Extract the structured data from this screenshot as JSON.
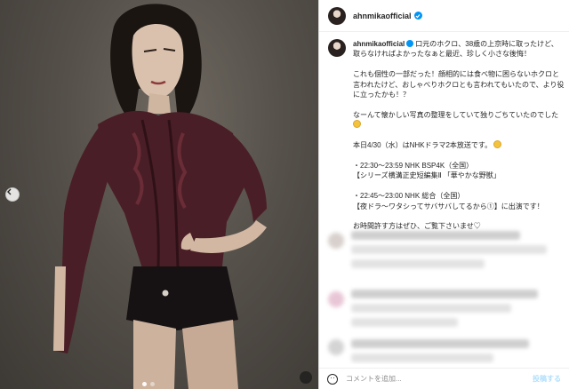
{
  "post": {
    "username": "ahnmikaofficial",
    "caption_lines": [
      "口元のホクロ、38歳の上京時に取ったけど、取らなければよかったなぁと最近、珍しく小さな後悔！",
      "",
      "これも個性の一部だった！顔相的には食べ物に困らないホクロと言われたけど、おしゃべりホクロとも言われてもいたので、より役に立ったかも！？",
      "",
      "なーんて懐かしい写真の整理をしていて独りごちていたのでした",
      "",
      "本日4/30（水）はNHKドラマ2本放送です。",
      "",
      "・22:30〜23:59 NHK BSP4K（全国）",
      "【シリーズ横溝正史短編集Ⅱ 「華やかな野獣」",
      "",
      "・22:45〜23:00 NHK 総合（全国）",
      "【夜ドラ〜ワタシってサバサバしてるから①】に出演です！",
      "",
      "お時間許す方はぜひ、ご覧下さいませ♡"
    ]
  },
  "comment_bar": {
    "placeholder": "コメントを追加...",
    "post_label": "投稿する"
  },
  "icons": {
    "prev": "chevron-left-icon",
    "verified": "verified-badge-icon",
    "emoji": "emoji-smile-icon"
  },
  "colors": {
    "verified": "#0095f6",
    "post_disabled": "#b2dffc",
    "blouse": "#4a1e26"
  }
}
